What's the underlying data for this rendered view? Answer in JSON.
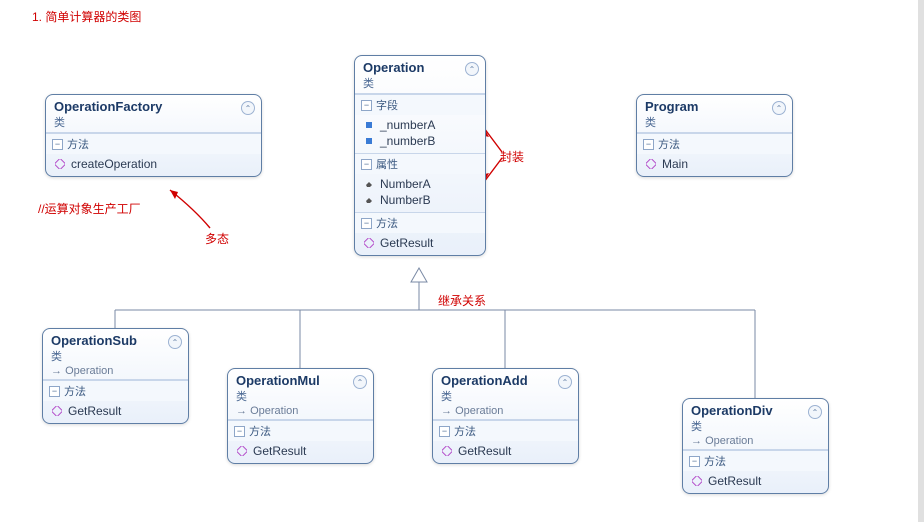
{
  "title": "1. 简单计算器的类图",
  "annotations": {
    "factory_comment": "//运算对象生产工厂",
    "poly_label": "多态",
    "encapsulation_label": "封装",
    "inherit_label": "继承关系"
  },
  "section_labels": {
    "fields": "字段",
    "properties": "属性",
    "methods": "方法"
  },
  "stereotype": "类",
  "inherit_arrow_label": "Operation",
  "classes": {
    "operation": {
      "name": "Operation",
      "fields": [
        "_numberA",
        "_numberB"
      ],
      "properties": [
        "NumberA",
        "NumberB"
      ],
      "methods": [
        "GetResult"
      ]
    },
    "factory": {
      "name": "OperationFactory",
      "methods": [
        "createOperation"
      ]
    },
    "program": {
      "name": "Program",
      "methods": [
        "Main"
      ]
    },
    "sub": {
      "name": "OperationSub",
      "methods": [
        "GetResult"
      ]
    },
    "mul": {
      "name": "OperationMul",
      "methods": [
        "GetResult"
      ]
    },
    "add": {
      "name": "OperationAdd",
      "methods": [
        "GetResult"
      ]
    },
    "div": {
      "name": "OperationDiv",
      "methods": [
        "GetResult"
      ]
    }
  }
}
